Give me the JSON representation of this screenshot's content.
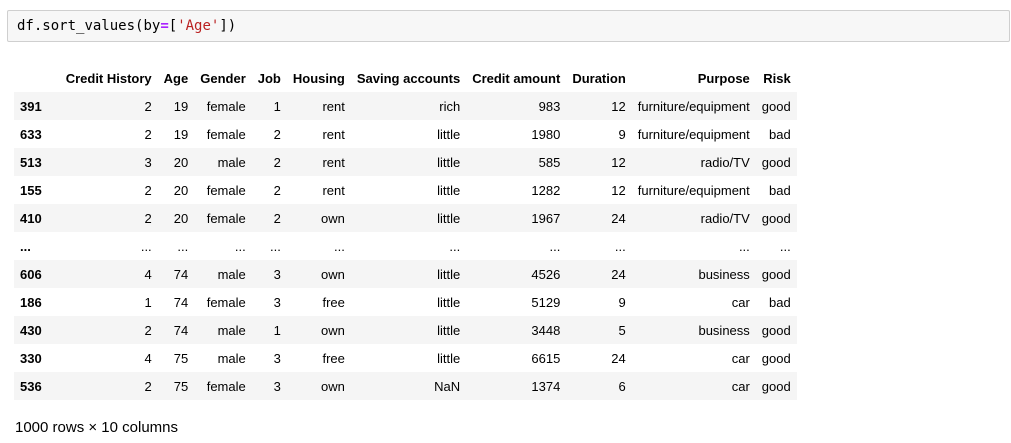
{
  "code_cell": {
    "tokens": [
      {
        "t": "df",
        "c": "tok-name"
      },
      {
        "t": ".",
        "c": "tok-punct"
      },
      {
        "t": "sort_values",
        "c": "tok-name"
      },
      {
        "t": "(",
        "c": "tok-punct"
      },
      {
        "t": "by",
        "c": "tok-name"
      },
      {
        "t": "=",
        "c": "tok-op"
      },
      {
        "t": "[",
        "c": "tok-punct"
      },
      {
        "t": "'Age'",
        "c": "tok-str"
      },
      {
        "t": "])",
        "c": "tok-punct"
      }
    ]
  },
  "table": {
    "index_header": "",
    "columns": [
      "Credit History",
      "Age",
      "Gender",
      "Job",
      "Housing",
      "Saving accounts",
      "Credit amount",
      "Duration",
      "Purpose",
      "Risk"
    ],
    "rows": [
      {
        "index": "391",
        "cells": [
          "2",
          "19",
          "female",
          "1",
          "rent",
          "rich",
          "983",
          "12",
          "furniture/equipment",
          "good"
        ]
      },
      {
        "index": "633",
        "cells": [
          "2",
          "19",
          "female",
          "2",
          "rent",
          "little",
          "1980",
          "9",
          "furniture/equipment",
          "bad"
        ]
      },
      {
        "index": "513",
        "cells": [
          "3",
          "20",
          "male",
          "2",
          "rent",
          "little",
          "585",
          "12",
          "radio/TV",
          "good"
        ]
      },
      {
        "index": "155",
        "cells": [
          "2",
          "20",
          "female",
          "2",
          "rent",
          "little",
          "1282",
          "12",
          "furniture/equipment",
          "bad"
        ]
      },
      {
        "index": "410",
        "cells": [
          "2",
          "20",
          "female",
          "2",
          "own",
          "little",
          "1967",
          "24",
          "radio/TV",
          "good"
        ]
      },
      {
        "index": "...",
        "cells": [
          "...",
          "...",
          "...",
          "...",
          "...",
          "...",
          "...",
          "...",
          "...",
          "..."
        ]
      },
      {
        "index": "606",
        "cells": [
          "4",
          "74",
          "male",
          "3",
          "own",
          "little",
          "4526",
          "24",
          "business",
          "good"
        ]
      },
      {
        "index": "186",
        "cells": [
          "1",
          "74",
          "female",
          "3",
          "free",
          "little",
          "5129",
          "9",
          "car",
          "bad"
        ]
      },
      {
        "index": "430",
        "cells": [
          "2",
          "74",
          "male",
          "1",
          "own",
          "little",
          "3448",
          "5",
          "business",
          "good"
        ]
      },
      {
        "index": "330",
        "cells": [
          "4",
          "75",
          "male",
          "3",
          "free",
          "little",
          "6615",
          "24",
          "car",
          "good"
        ]
      },
      {
        "index": "536",
        "cells": [
          "2",
          "75",
          "female",
          "3",
          "own",
          "NaN",
          "1374",
          "6",
          "car",
          "good"
        ]
      }
    ]
  },
  "summary": "1000 rows × 10 columns"
}
